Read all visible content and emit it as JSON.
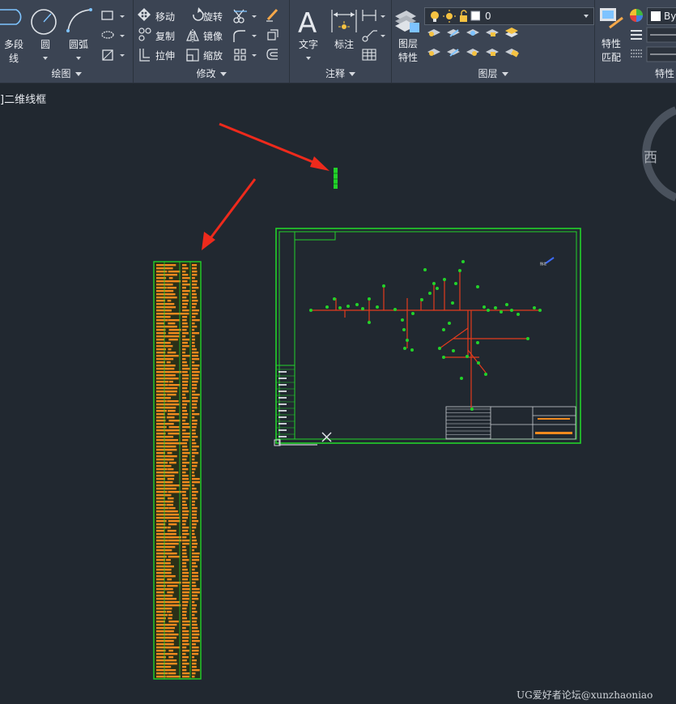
{
  "ribbon": {
    "draw": {
      "title": "绘图",
      "polyline": "多段线",
      "circle": "圆",
      "arc": "圆弧"
    },
    "modify": {
      "title": "修改",
      "move": "移动",
      "rotate": "旋转",
      "copy": "复制",
      "mirror": "镜像",
      "stretch": "拉伸",
      "scale": "缩放"
    },
    "annotation": {
      "title": "注释",
      "text": "文字",
      "dimension": "标注"
    },
    "layers": {
      "title": "图层",
      "layer_properties_line1": "图层",
      "layer_properties_line2": "特性",
      "current_layer": "0"
    },
    "properties": {
      "title": "特性",
      "match_line1": "特性",
      "match_line2": "匹配",
      "bylayer": "By"
    }
  },
  "viewport": {
    "label": "]二维线框",
    "compass_west": "西"
  },
  "watermark": "UG爱好者论坛@xunzhaoniao",
  "colors": {
    "canvas": "#212830",
    "ribbon": "#3b4453",
    "drawing_green": "#22d22a",
    "drawing_red": "#e33b1c",
    "table_orange": "#f08a1e",
    "arrow_red": "#ee2a1c"
  }
}
